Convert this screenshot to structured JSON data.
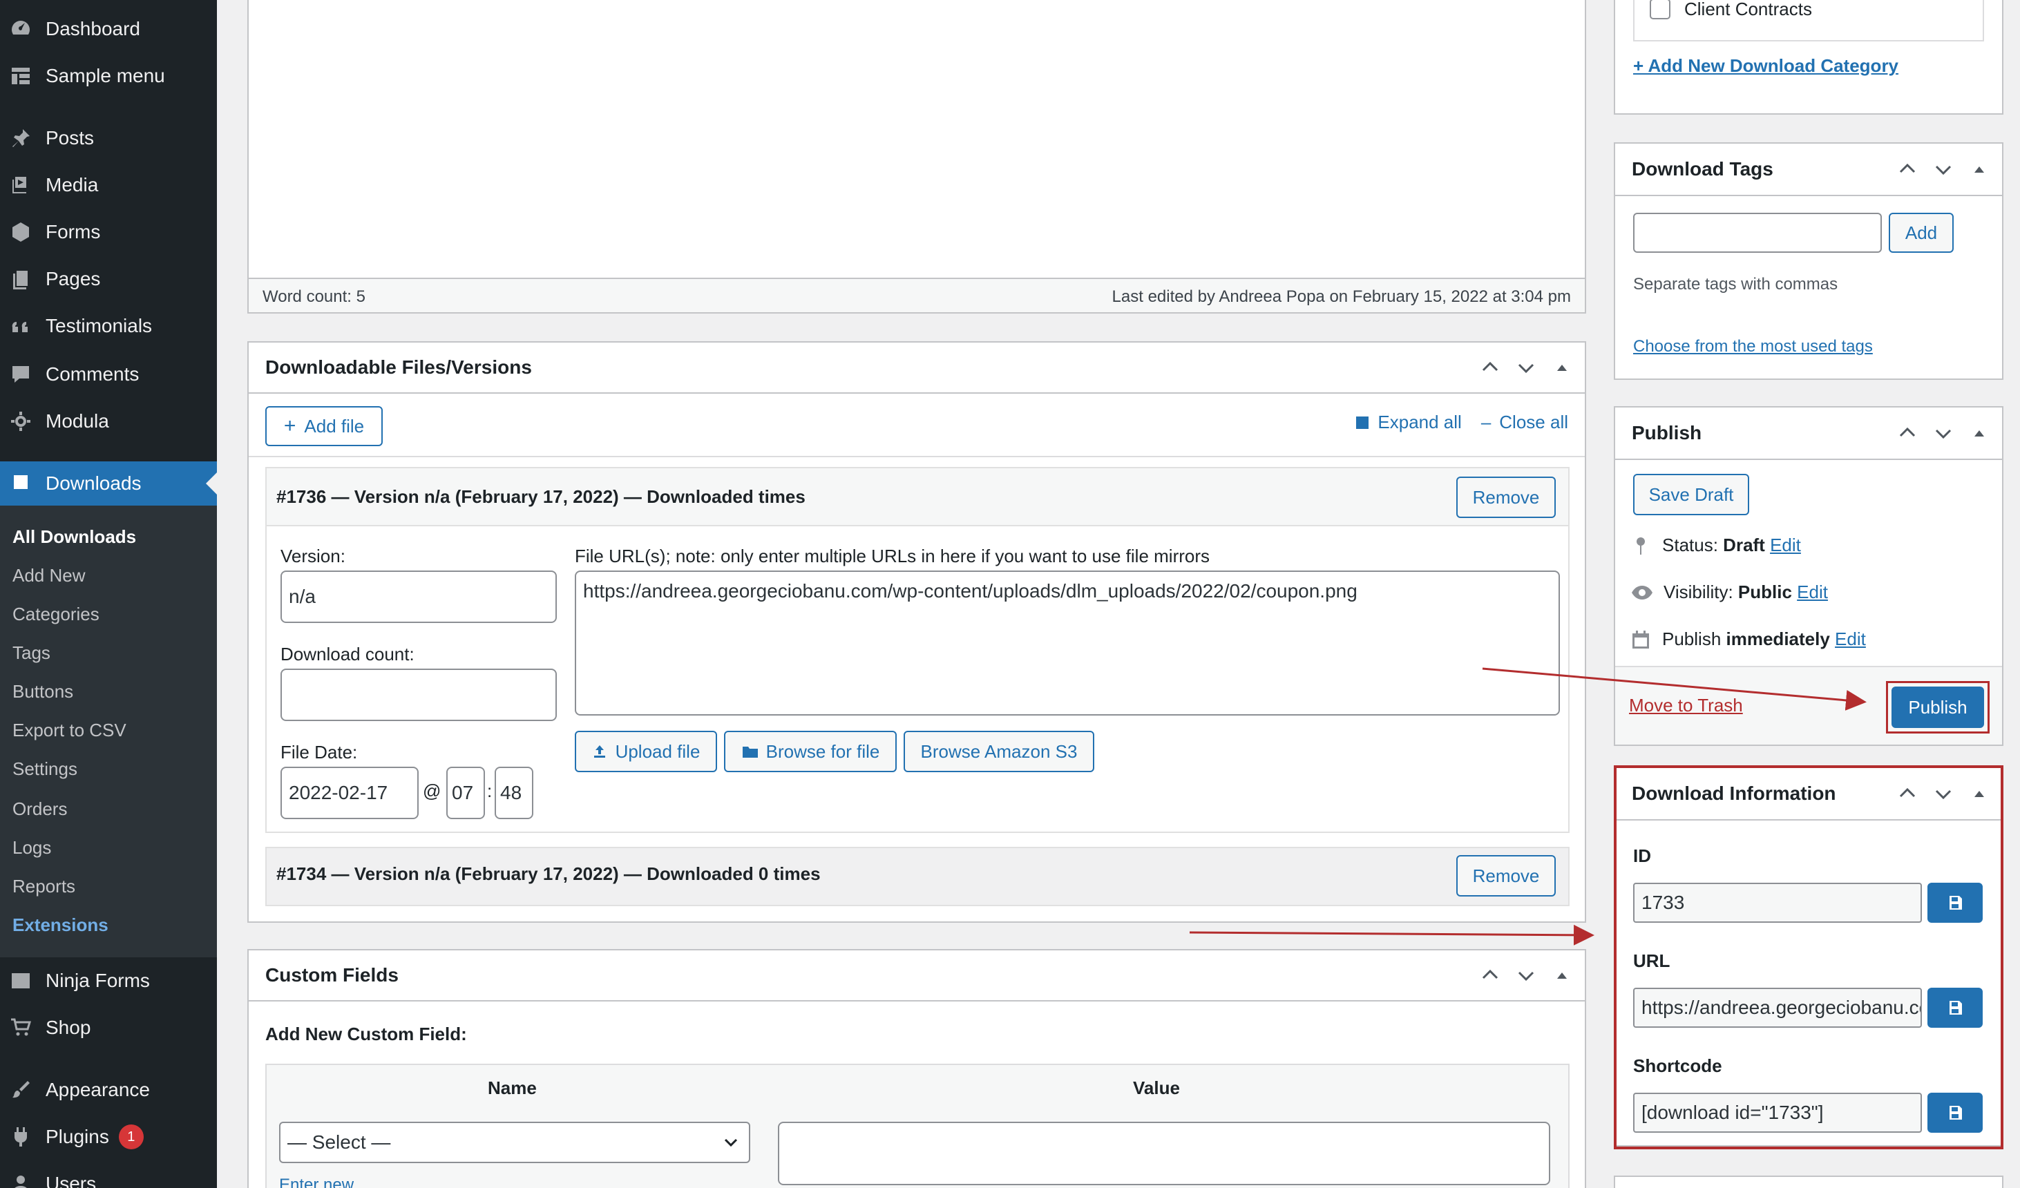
{
  "sidebar": {
    "menu": {
      "dashboard": "Dashboard",
      "sample_menu": "Sample menu",
      "posts": "Posts",
      "media": "Media",
      "forms": "Forms",
      "pages": "Pages",
      "testimonials": "Testimonials",
      "comments": "Comments",
      "modula": "Modula",
      "downloads": "Downloads",
      "ninja_forms": "Ninja Forms",
      "shop": "Shop",
      "appearance": "Appearance",
      "plugins": "Plugins",
      "plugins_badge": "1",
      "users": "Users"
    },
    "submenu": {
      "all_downloads": "All Downloads",
      "add_new": "Add New",
      "categories": "Categories",
      "tags": "Tags",
      "buttons": "Buttons",
      "export_csv": "Export to CSV",
      "settings": "Settings",
      "orders": "Orders",
      "logs": "Logs",
      "reports": "Reports",
      "extensions": "Extensions"
    }
  },
  "editor": {
    "word_count": "Word count: 5",
    "last_edited": "Last edited by Andreea Popa on February 15, 2022 at 3:04 pm"
  },
  "files_panel": {
    "title": "Downloadable Files/Versions",
    "add_file": "Add file",
    "expand_all": "Expand all",
    "close_all": "Close all",
    "version1": {
      "header": "#1736 — Version n/a (February 17, 2022) — Downloaded times",
      "remove": "Remove",
      "version_label": "Version:",
      "version_value": "n/a",
      "count_label": "Download count:",
      "count_value": "",
      "date_label": "File Date:",
      "date_value": "2022-02-17",
      "at": "@",
      "hour": "07",
      "colon": ":",
      "minute": "48",
      "urls_label": "File URL(s); note: only enter multiple URLs in here if you want to use file mirrors",
      "urls_value": "https://andreea.georgeciobanu.com/wp-content/uploads/dlm_uploads/2022/02/coupon.png",
      "upload_file": "Upload file",
      "browse_file": "Browse for file",
      "browse_s3": "Browse Amazon S3"
    },
    "version2": {
      "header": "#1734 — Version n/a (February 17, 2022) — Downloaded 0 times",
      "remove": "Remove"
    }
  },
  "custom_fields": {
    "title": "Custom Fields",
    "add_new_label": "Add New Custom Field:",
    "col_name": "Name",
    "col_value": "Value",
    "select_value": "— Select —",
    "enter_new": "Enter new"
  },
  "right": {
    "categories": {
      "item": "Client Contracts",
      "add_new": "+ Add New Download Category"
    },
    "tags": {
      "title": "Download Tags",
      "add": "Add",
      "hint": "Separate tags with commas",
      "choose": "Choose from the most used tags"
    },
    "publish": {
      "title": "Publish",
      "save_draft": "Save Draft",
      "status_label": "Status:",
      "status_value": "Draft",
      "visibility_label": "Visibility:",
      "visibility_value": "Public",
      "publish_label": "Publish",
      "publish_value": "immediately",
      "edit": "Edit",
      "move_trash": "Move to Trash",
      "publish_button": "Publish"
    },
    "download_info": {
      "title": "Download Information",
      "id_label": "ID",
      "id_value": "1733",
      "url_label": "URL",
      "url_value": "https://andreea.georgeciobanu.com/download/coupon/",
      "shortcode_label": "Shortcode",
      "shortcode_value": "[download id=\"1733\"]"
    }
  },
  "colors": {
    "sidebar_bg": "#1d2327",
    "accent": "#2271b1",
    "annotation_red": "#b32d2e",
    "badge_red": "#d63638"
  }
}
